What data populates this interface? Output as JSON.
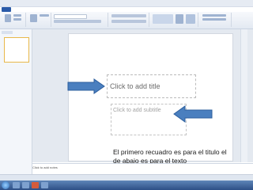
{
  "slide": {
    "title_placeholder": "Click to add title",
    "subtitle_placeholder": "Click to add subtitle"
  },
  "notes": {
    "placeholder": "Click to add notes"
  },
  "caption": {
    "line1": "El primero recuadro es para el titulo el",
    "line2": "de abajo es para el texto"
  },
  "colors": {
    "arrow": "#4a7fbf",
    "ribbon_tab_file": "#2a5aa8"
  }
}
